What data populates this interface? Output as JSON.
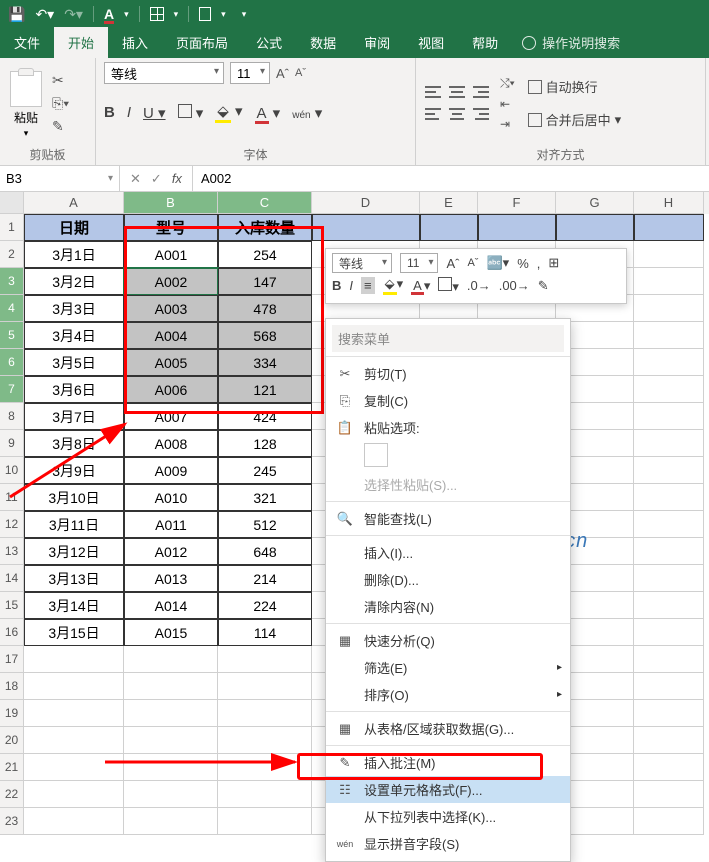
{
  "qat": {
    "letter": "A"
  },
  "tabs": {
    "t0": "文件",
    "t1": "开始",
    "t2": "插入",
    "t3": "页面布局",
    "t4": "公式",
    "t5": "数据",
    "t6": "审阅",
    "t7": "视图",
    "t8": "帮助",
    "search": "操作说明搜索"
  },
  "ribbon": {
    "clipboard_label": "剪贴板",
    "paste": "粘贴",
    "font_label": "字体",
    "font_name": "等线",
    "font_size": "11",
    "wen": "wén",
    "align_label": "对齐方式",
    "wrap": "自动换行",
    "merge": "合并后居中"
  },
  "namebox": "B3",
  "formula": "A002",
  "columns": [
    "A",
    "B",
    "C",
    "D",
    "E",
    "F",
    "G",
    "H"
  ],
  "headers": {
    "A": "日期",
    "B": "型号",
    "C": "入库数量"
  },
  "chart_data": {
    "type": "table",
    "columns": [
      "日期",
      "型号",
      "入库数量"
    ],
    "rows": [
      [
        "3月1日",
        "A001",
        "254"
      ],
      [
        "3月2日",
        "A002",
        "147"
      ],
      [
        "3月3日",
        "A003",
        "478"
      ],
      [
        "3月4日",
        "A004",
        "568"
      ],
      [
        "3月5日",
        "A005",
        "334"
      ],
      [
        "3月6日",
        "A006",
        "121"
      ],
      [
        "3月7日",
        "A007",
        "424"
      ],
      [
        "3月8日",
        "A008",
        "128"
      ],
      [
        "3月9日",
        "A009",
        "245"
      ],
      [
        "3月10日",
        "A010",
        "321"
      ],
      [
        "3月11日",
        "A011",
        "512"
      ],
      [
        "3月12日",
        "A012",
        "648"
      ],
      [
        "3月13日",
        "A013",
        "214"
      ],
      [
        "3月14日",
        "A014",
        "224"
      ],
      [
        "3月15日",
        "A015",
        "114"
      ]
    ]
  },
  "mini": {
    "font": "等线",
    "size": "11",
    "a_inc": "A",
    "a_dec": "A"
  },
  "ctx": {
    "search": "搜索菜单",
    "cut": "剪切(T)",
    "copy": "复制(C)",
    "paste_opts": "粘贴选项:",
    "paste_sp": "选择性粘贴(S)...",
    "smart": "智能查找(L)",
    "insert": "插入(I)...",
    "delete": "删除(D)...",
    "clear": "清除内容(N)",
    "quick": "快速分析(Q)",
    "filter": "筛选(E)",
    "sort": "排序(O)",
    "from_table": "从表格/区域获取数据(G)...",
    "comment": "插入批注(M)",
    "format": "设置单元格格式(F)...",
    "picklist": "从下拉列表中选择(K)...",
    "pinyin": "显示拼音字段(S)"
  },
  "watermark": "passneo.cn"
}
